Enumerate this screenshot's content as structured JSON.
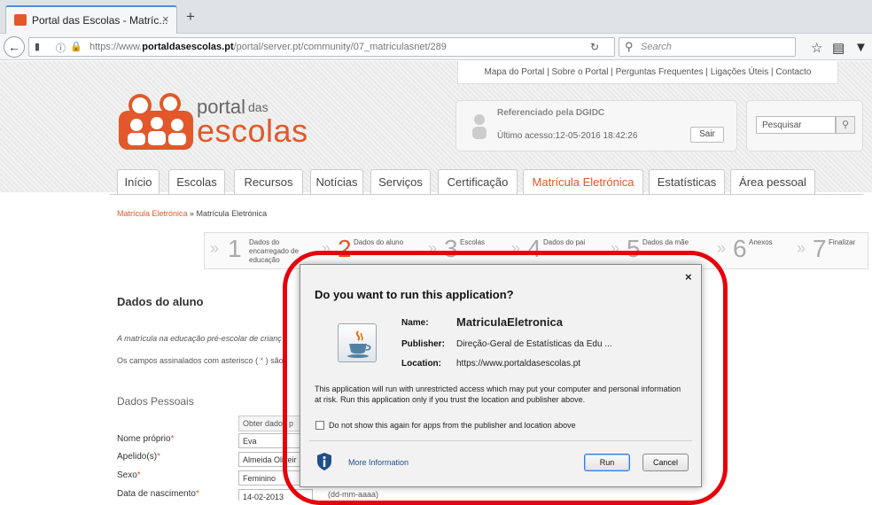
{
  "browser": {
    "tab_title": "Portal das Escolas - Matríc...",
    "tab_close": "×",
    "new_tab": "+",
    "url_prefix": "https://www.",
    "url_domain": "portaldasescolas.pt",
    "url_path": "/portal/server.pt/community/07_matriculasnet/289",
    "search_placeholder": "Search"
  },
  "site": {
    "top_links": "Mapa do Portal | Sobre o Portal | Perguntas Frequentes | Ligações Úteis | Contacto",
    "logo_portal": "portal",
    "logo_das": "das",
    "logo_escolas": "escolas",
    "user_ref": "Referenciado pela DGIDC",
    "last_access": "Último acesso:12-05-2016 18:42:26",
    "logout_label": "Sair",
    "search_placeholder": "Pesquisar",
    "menu": [
      {
        "label": "Início"
      },
      {
        "label": "Escolas"
      },
      {
        "label": "Recursos"
      },
      {
        "label": "Notícias"
      },
      {
        "label": "Serviços"
      },
      {
        "label": "Certificação"
      },
      {
        "label": "Matrícula Eletrónica"
      },
      {
        "label": "Estatísticas"
      },
      {
        "label": "Área pessoal"
      }
    ],
    "breadcrumb_link": "Matrícula Eletrónica",
    "breadcrumb_rest": " » Matrícula Eletrónica",
    "steps": [
      {
        "num": "1",
        "label": "Dados do encarregado de educação"
      },
      {
        "num": "2",
        "label": "Dados do aluno"
      },
      {
        "num": "3",
        "label": "Escolas"
      },
      {
        "num": "4",
        "label": "Dados do pai"
      },
      {
        "num": "5",
        "label": "Dados da mãe"
      },
      {
        "num": "6",
        "label": "Anexos"
      },
      {
        "num": "7",
        "label": "Finalizar"
      }
    ],
    "step_arrow": "»",
    "section_title": "Dados do aluno",
    "intro_italic": "A matrícula na educação pré-escolar de crianç",
    "intro_required_a": "Os campos assinalados com asterisco (",
    "intro_required_star": " * ",
    "intro_required_b": ") são",
    "personal_title": "Dados Pessoais",
    "obter_button": "Obter dados p",
    "fields": [
      {
        "label": "Nome próprio",
        "value": "Eva"
      },
      {
        "label": "Apelido(s)",
        "value": "Almeida Oliveir"
      },
      {
        "label": "Sexo",
        "value": "Feminino"
      },
      {
        "label": "Data de nascimento",
        "value": "14-02-2013"
      }
    ],
    "asterisk": "*",
    "date_hint": "(dd-mm-aaaa)"
  },
  "dialog": {
    "close": "×",
    "title": "Do you want to run this application?",
    "name_key": "Name:",
    "name_value": "MatriculaEletronica",
    "publisher_key": "Publisher:",
    "publisher_value": "Direção-Geral de Estatísticas da Edu ...",
    "location_key": "Location:",
    "location_value": "https://www.portaldasescolas.pt",
    "warning": "This application will run with unrestricted access which may put your computer and personal information at risk. Run this application only if you trust the location and publisher above.",
    "checkbox_label": "Do not show this again for apps from the publisher and location above",
    "more_info": "More Information",
    "run_label": "Run",
    "cancel_label": "Cancel"
  },
  "colors": {
    "brand_orange": "#e2582a",
    "annotation_red": "#e8000b"
  },
  "icons": {
    "back": "back-arrow-icon",
    "reload": "reload-icon",
    "search": "search-icon",
    "bookmark": "star-icon",
    "java": "java-cup-icon",
    "info": "shield-info-icon"
  }
}
